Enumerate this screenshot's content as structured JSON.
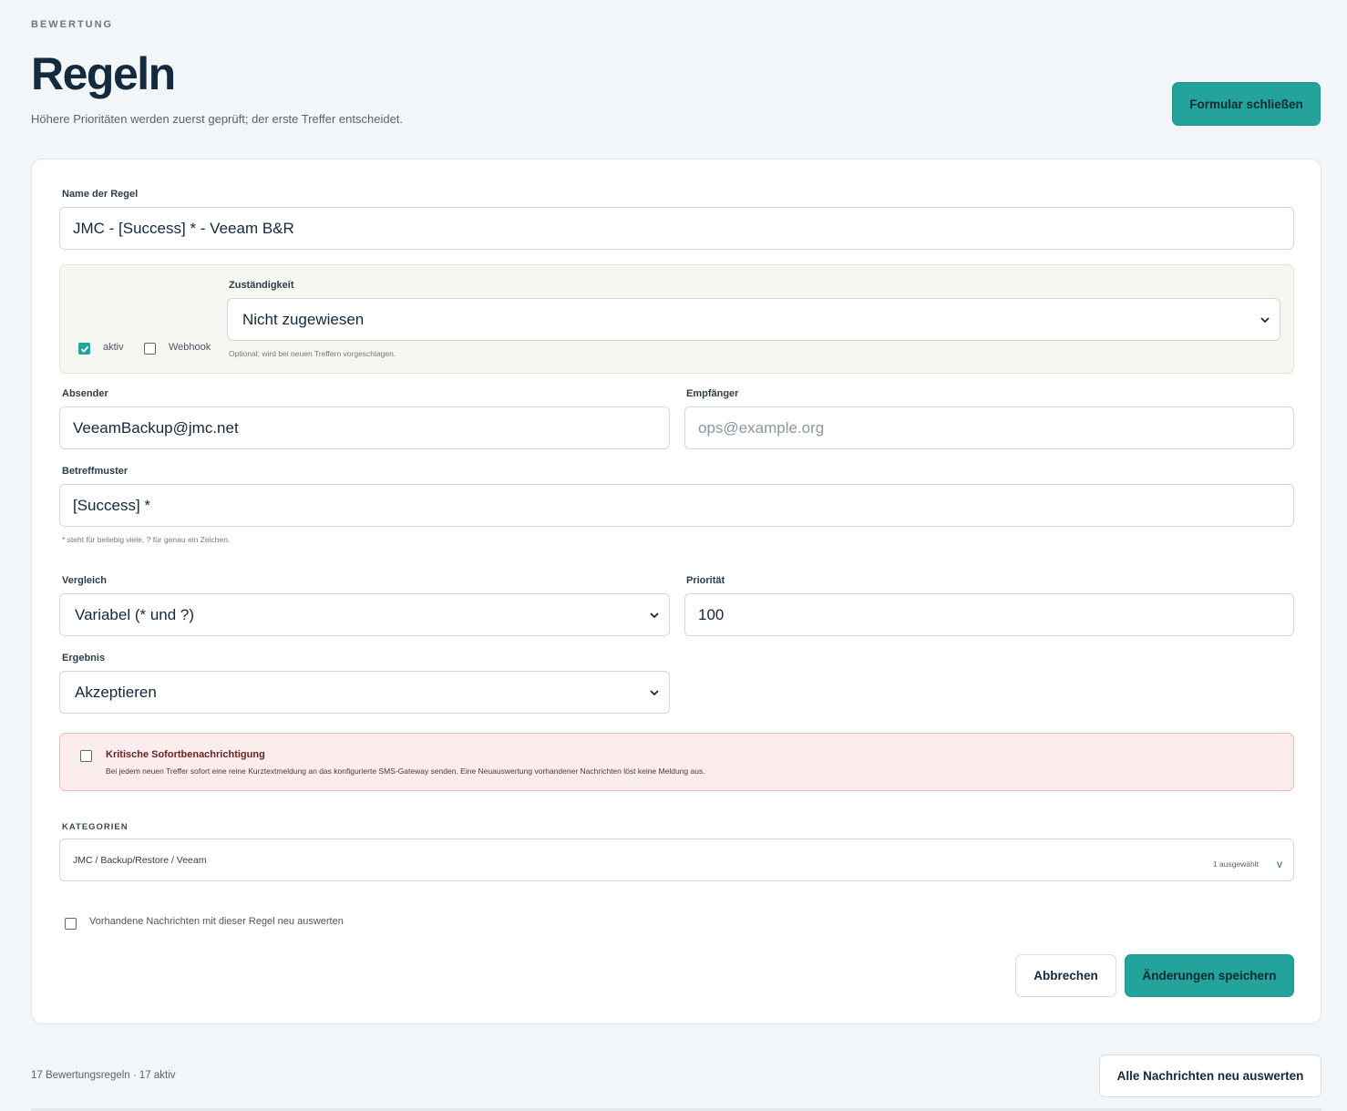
{
  "header": {
    "eyebrow": "BEWERTUNG",
    "title": "Regeln",
    "subtitle": "Höhere Prioritäten werden zuerst geprüft; der erste Treffer entscheidet.",
    "close_form_label": "Formular schließen"
  },
  "form": {
    "name": {
      "label": "Name der Regel",
      "value": "JMC - [Success] * - Veeam B&R"
    },
    "active": {
      "label": "aktiv",
      "checked": true
    },
    "webhook": {
      "label": "Webhook",
      "checked": false
    },
    "responsibility": {
      "label": "Zuständigkeit",
      "value": "Nicht zugewiesen",
      "hint": "Optional; wird bei neuen Treffern vorgeschlagen."
    },
    "sender": {
      "label": "Absender",
      "value": "VeeamBackup@jmc.net"
    },
    "recipient": {
      "label": "Empfänger",
      "placeholder": "ops@example.org"
    },
    "subject": {
      "label": "Betreffmuster",
      "value": "[Success] *",
      "hint": "* steht für beliebig viele, ? für genau ein Zeichen."
    },
    "comparison": {
      "label": "Vergleich",
      "value": "Variabel (* und ?)"
    },
    "priority": {
      "label": "Priorität",
      "value": "100"
    },
    "result": {
      "label": "Ergebnis",
      "value": "Akzeptieren"
    },
    "critical": {
      "title": "Kritische Sofortbenachrichtigung",
      "text": "Bei jedem neuen Treffer sofort eine reine Kurztextmeldung an das konfigurierte SMS-Gateway senden. Eine Neuauswertung vorhandener Nachrichten löst keine Meldung aus.",
      "checked": false
    },
    "categories": {
      "label": "KATEGORIEN",
      "value": "JMC / Backup/Restore / Veeam",
      "count": "1 ausgewählt",
      "chevron": "v"
    },
    "reevaluate": {
      "label": "Vorhandene Nachrichten mit dieser Regel neu auswerten",
      "checked": false
    },
    "cancel_label": "Abbrechen",
    "save_label": "Änderungen speichern"
  },
  "footer": {
    "summary": "17 Bewertungsregeln · 17 aktiv",
    "reevaluate_all_label": "Alle Nachrichten neu auswerten"
  },
  "colors": {
    "accent": "#23a39b",
    "title": "#142a3f",
    "alert_bg": "#fbedec",
    "alert_border": "#e9b9b6",
    "group_bg": "#f6f7f0"
  }
}
